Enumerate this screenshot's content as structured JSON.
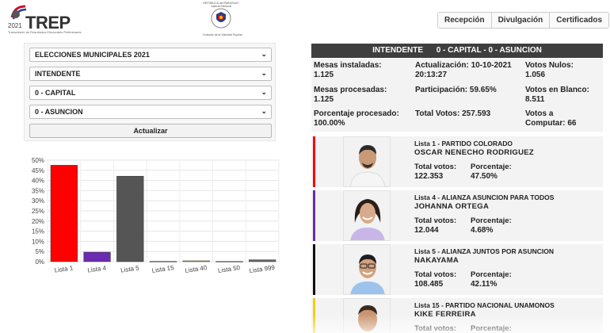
{
  "header": {
    "logo_year": "2021",
    "logo_text": "TREP",
    "logo_subtitle": "Transmisión de Resultados Electorales Preliminares",
    "seal_top": "REPÚBLICA del PARAGUAY\nJusticia Electoral",
    "seal_bottom": "Custodio de la Voluntad Popular",
    "nav": [
      "Recepción",
      "Divulgación",
      "Certificados"
    ]
  },
  "filters": {
    "election": "ELECCIONES MUNICIPALES 2021",
    "position": "INTENDENTE",
    "department": "0 - CAPITAL",
    "district": "0 - ASUNCION",
    "update_label": "Actualizar"
  },
  "chart_data": {
    "type": "bar",
    "categories": [
      "Lista 1",
      "Lista 4",
      "Lista 5",
      "Lista 15",
      "Lista 40",
      "Lista 50",
      "Lista 999"
    ],
    "values": [
      47.5,
      4.68,
      42.11,
      0.2,
      0.4,
      0.1,
      0.9
    ],
    "colors": [
      "#ff0000",
      "#6a2bb0",
      "#555555",
      "#cccccc",
      "#e0a000",
      "#cccccc",
      "#666666"
    ],
    "yticks": [
      "0%",
      "5%",
      "10%",
      "15%",
      "20%",
      "25%",
      "30%",
      "35%",
      "40%",
      "45%",
      "50%"
    ],
    "ylim": [
      0,
      50
    ],
    "grid": true
  },
  "results": {
    "header": "INTENDENTE      0 - CAPITAL - 0 - ASUNCION",
    "mesas_instaladas_label": "Mesas instaladas:",
    "mesas_instaladas": "1.125",
    "actualizacion_label": "Actualización: 10-10-2021",
    "actualizacion_time": "20:13:27",
    "nulos_label": "Votos Nulos:",
    "nulos": "1.056",
    "mesas_procesadas_label": "Mesas procesadas:",
    "mesas_procesadas": "1.125",
    "participacion": "Participación: 59.65%",
    "blancos_label": "Votos en Blanco:",
    "blancos": "8.511",
    "porcentaje_label": "Porcentaje procesado:",
    "porcentaje": "100.00%",
    "total_votos": "Total Votos: 257.593",
    "computar_label": "Votos a",
    "computar": "Computar: 66"
  },
  "candidates": [
    {
      "lista": "Lista 1 - PARTIDO COLORADO",
      "name": "OSCAR NENECHO RODRIGUEZ",
      "total_label": "Total votos:",
      "total": "122.353",
      "pct_label": "Porcentaje:",
      "pct": "47.50%",
      "color": "#ff0000"
    },
    {
      "lista": "Lista 4 - ALIANZA ASUNCION PARA TODOS",
      "name": "JOHANNA ORTEGA",
      "total_label": "Total votos:",
      "total": "12.044",
      "pct_label": "Porcentaje:",
      "pct": "4.68%",
      "color": "#6a2bb0"
    },
    {
      "lista": "Lista 5 - ALIANZA JUNTOS POR ASUNCION",
      "name": "NAKAYAMA",
      "total_label": "Total votos:",
      "total": "108.485",
      "pct_label": "Porcentaje:",
      "pct": "42.11%",
      "color": "#111111"
    },
    {
      "lista": "Lista 15 - PARTIDO NACIONAL UNAMONOS",
      "name": "KIKE FERREIRA",
      "total_label": "Total votos:",
      "total": "",
      "pct_label": "Porcentaje:",
      "pct": "",
      "color": "#f0d000"
    }
  ]
}
